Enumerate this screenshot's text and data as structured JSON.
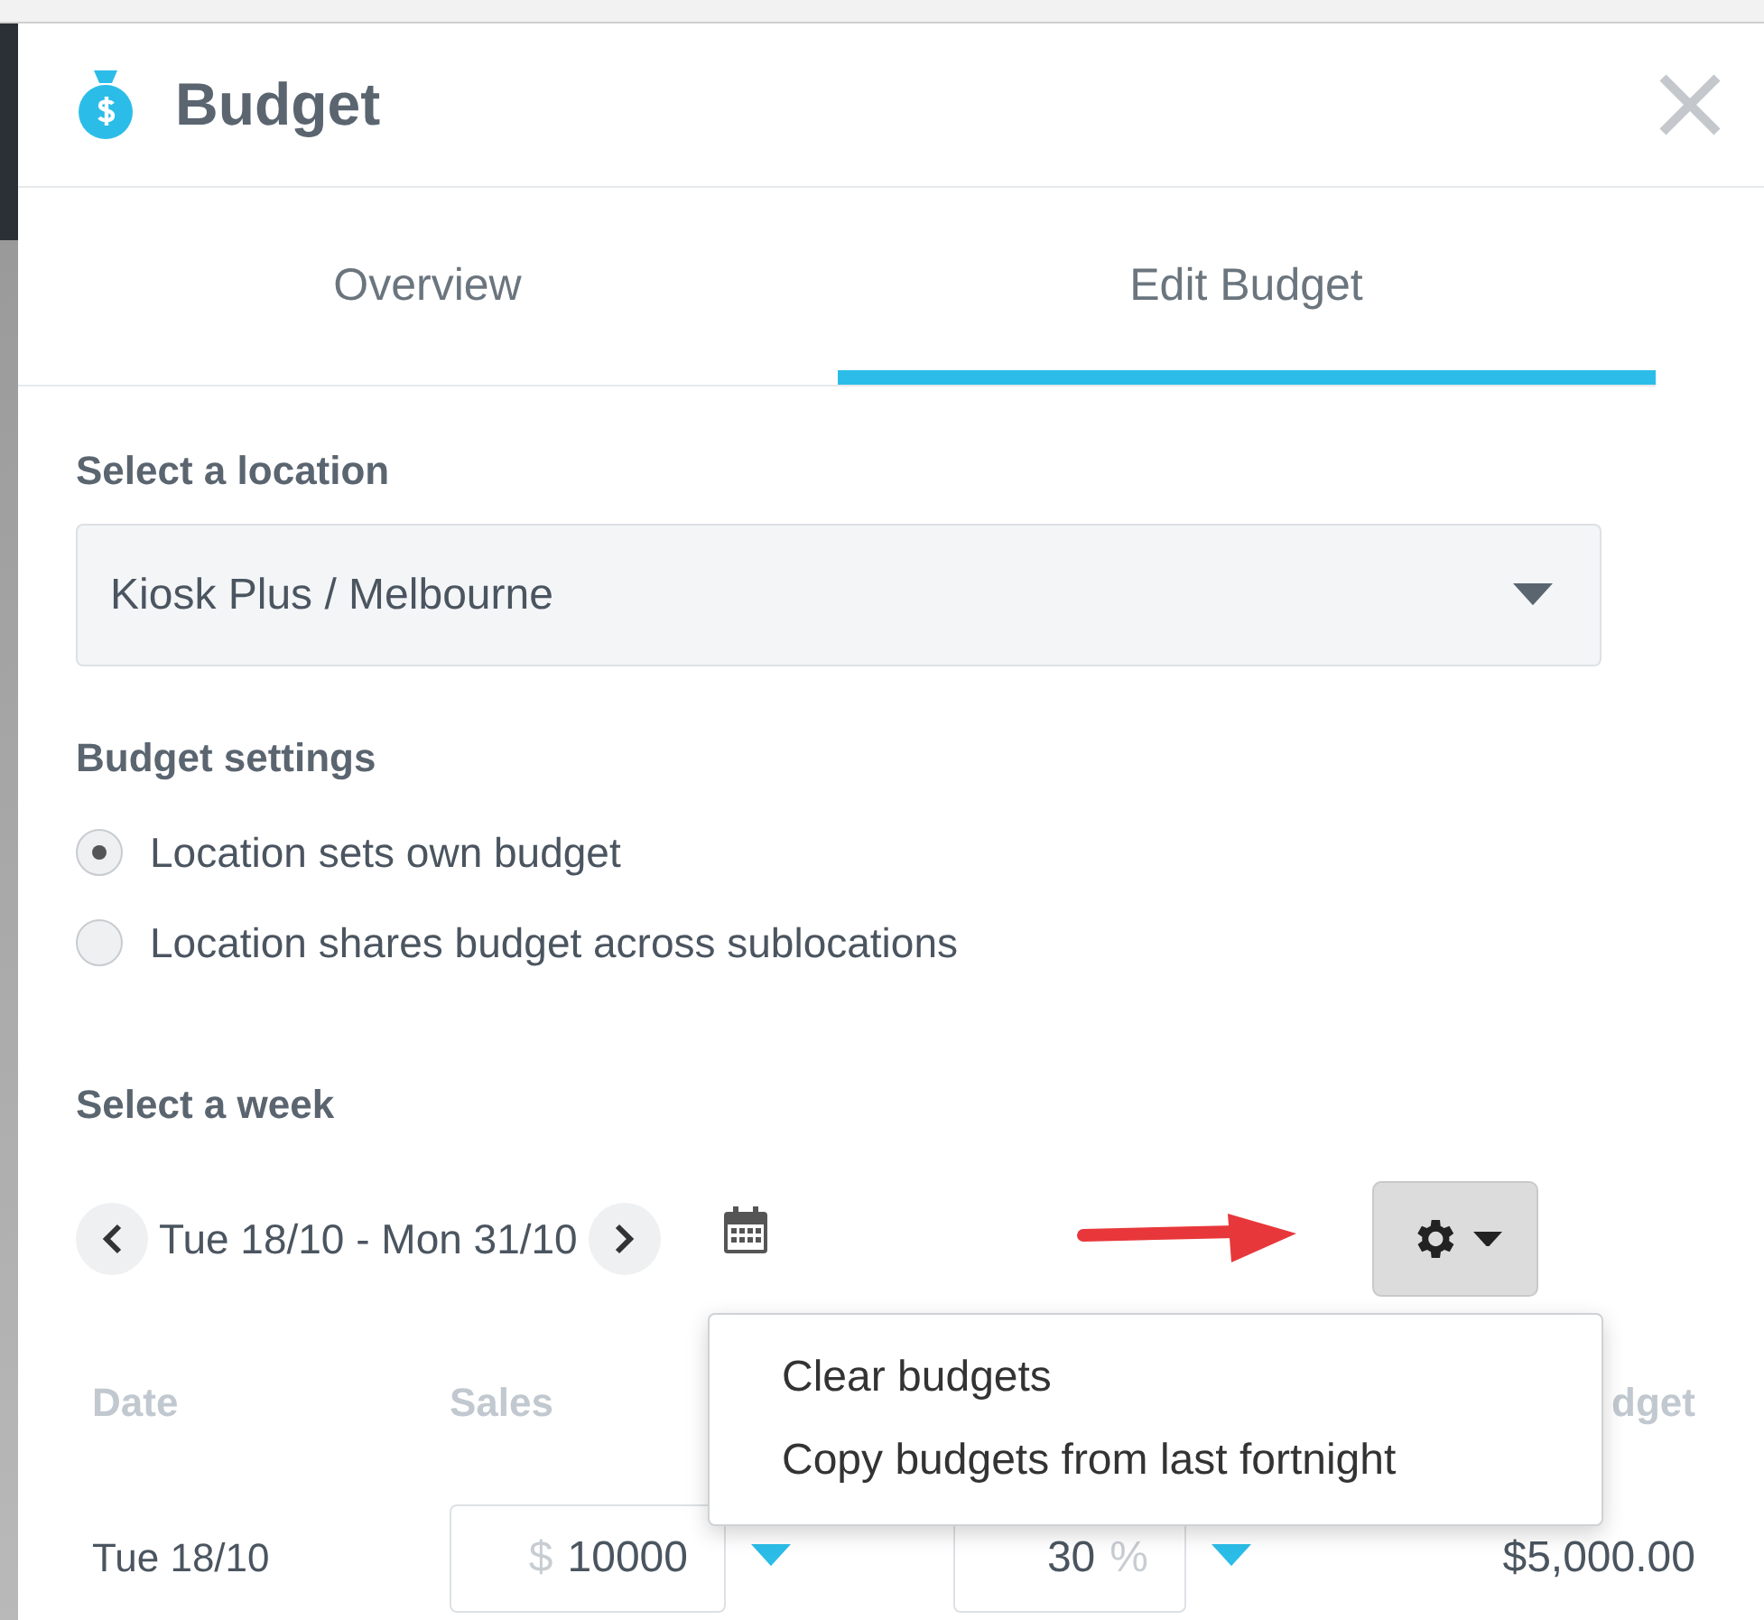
{
  "window": {
    "title": "Budget"
  },
  "tabs": [
    {
      "label": "Overview",
      "selected": false
    },
    {
      "label": "Edit Budget",
      "selected": true
    }
  ],
  "location": {
    "label": "Select a location",
    "value": "Kiosk Plus / Melbourne"
  },
  "budget_settings": {
    "label": "Budget settings",
    "options": [
      {
        "label": "Location sets own budget",
        "selected": true
      },
      {
        "label": "Location shares budget across sublocations",
        "selected": false
      }
    ]
  },
  "week": {
    "label": "Select a week",
    "range": "Tue 18/10 - Mon 31/10"
  },
  "settings_menu": {
    "open": true,
    "items": [
      "Clear budgets",
      "Copy budgets from last fortnight"
    ]
  },
  "table": {
    "columns": [
      "Date",
      "Sales",
      "dget"
    ],
    "rows": [
      {
        "date": "Tue 18/10",
        "currency": "$",
        "sales": "10000",
        "percent": "30",
        "percent_unit": "%",
        "budget": "$5,000.00"
      }
    ]
  }
}
